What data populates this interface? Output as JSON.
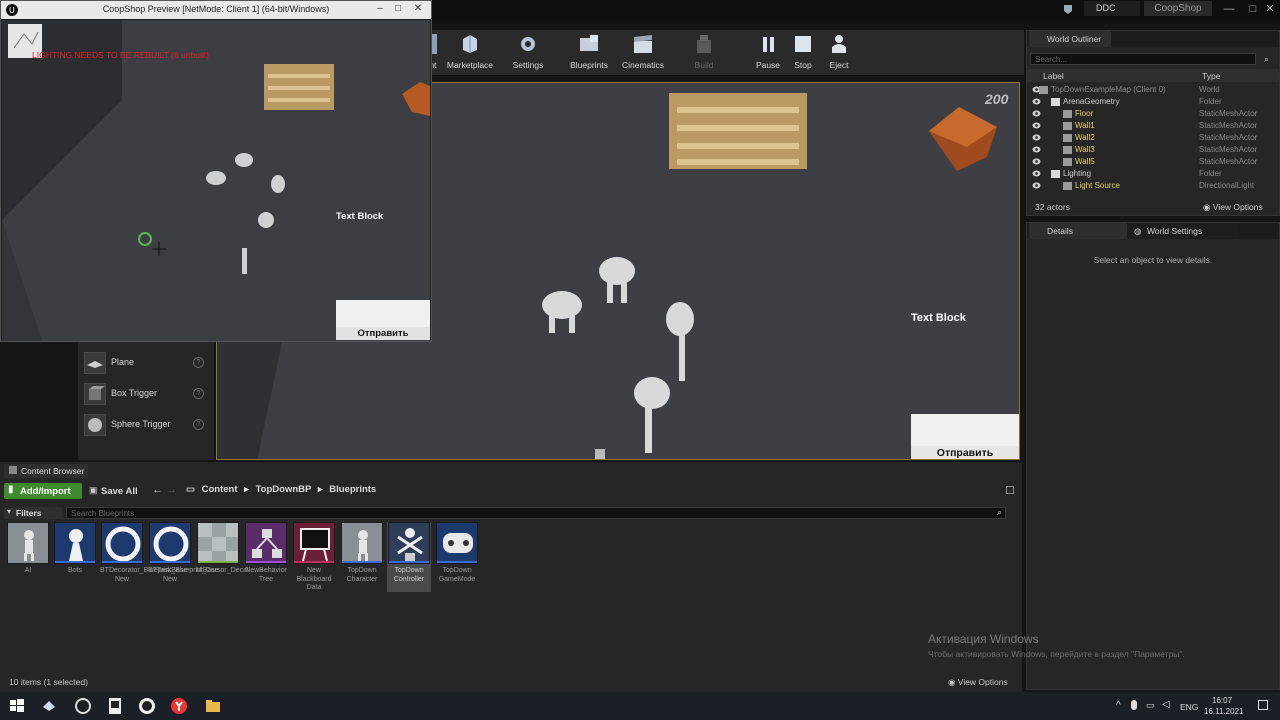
{
  "topbar": {
    "ddc": "DDC",
    "project": "CoopShop"
  },
  "preview": {
    "title": "CoopShop Preview [NetMode: Client 1]  (64-bit/Windows)",
    "warning": "LIGHTING NEEDS TO BE REBUILT (6 unbuilt)",
    "text_block": "Text Block",
    "send_button": "Отправить"
  },
  "toolbar": {
    "items": [
      {
        "label": "nt"
      },
      {
        "label": "Marketplace"
      },
      {
        "label": "Settings"
      },
      {
        "label": "Blueprints"
      },
      {
        "label": "Cinematics"
      },
      {
        "label": "Build"
      },
      {
        "label": "Pause"
      },
      {
        "label": "Stop"
      },
      {
        "label": "Eject"
      }
    ]
  },
  "viewport": {
    "text_block": "Text Block",
    "send_button": "Отправить",
    "corner_text": "200"
  },
  "place_actors": {
    "items": [
      {
        "label": "Plane",
        "help": "?"
      },
      {
        "label": "Box Trigger",
        "help": "?"
      },
      {
        "label": "Sphere Trigger",
        "help": "?"
      }
    ]
  },
  "outliner": {
    "tab": "World Outliner",
    "search_placeholder": "Search...",
    "col_label": "Label",
    "col_type": "Type",
    "rows": [
      {
        "label": "TopDownExampleMap (Client 0)",
        "type": "World"
      },
      {
        "label": "ArenaGeometry",
        "type": "Folder"
      },
      {
        "label": "Floor",
        "type": "StaticMeshActor"
      },
      {
        "label": "Wall1",
        "type": "StaticMeshActor"
      },
      {
        "label": "Wall2",
        "type": "StaticMeshActor"
      },
      {
        "label": "Wall3",
        "type": "StaticMeshActor"
      },
      {
        "label": "Wall5",
        "type": "StaticMeshActor"
      },
      {
        "label": "Lighting",
        "type": "Folder"
      },
      {
        "label": "Light Source",
        "type": "DirectionalLight"
      }
    ],
    "count": "32 actors",
    "view_options": "View Options"
  },
  "details": {
    "tab_details": "Details",
    "tab_world_settings": "World Settings",
    "empty_text": "Select an object to view details."
  },
  "content_browser": {
    "tab": "Content Browser",
    "add_import": "Add/Import",
    "save_all": "Save All",
    "path": [
      "Content",
      "TopDownBP",
      "Blueprints"
    ],
    "filters": "Filters",
    "search_placeholder": "Search Blueprints",
    "assets": [
      {
        "name": "AI",
        "icon": "mannequin-icon"
      },
      {
        "name": "Bots",
        "icon": "pawn-icon"
      },
      {
        "name": "BTDecorator_BlueprintBase New",
        "icon": "ring-icon"
      },
      {
        "name": "BTTask_BlueprintBase New",
        "icon": "ring-icon"
      },
      {
        "name": "M_Cursor_Decal",
        "icon": "material-icon"
      },
      {
        "name": "NewBehavior Tree",
        "icon": "behavior-tree-icon"
      },
      {
        "name": "New Blackboard Data",
        "icon": "blackboard-icon"
      },
      {
        "name": "TopDown Character",
        "icon": "mannequin-icon"
      },
      {
        "name": "TopDown Controller",
        "icon": "controller-icon"
      },
      {
        "name": "TopDown GameMode",
        "icon": "gamepad-icon"
      }
    ],
    "status": "10 items (1 selected)",
    "view_options": "View Options"
  },
  "watermark": {
    "title": "Активация Windows",
    "subtitle": "Чтобы активировать Windows, перейдите в раздел \"Параметры\"."
  },
  "taskbar": {
    "lang": "ENG",
    "time": "16:07",
    "date": "16.11.2021"
  }
}
